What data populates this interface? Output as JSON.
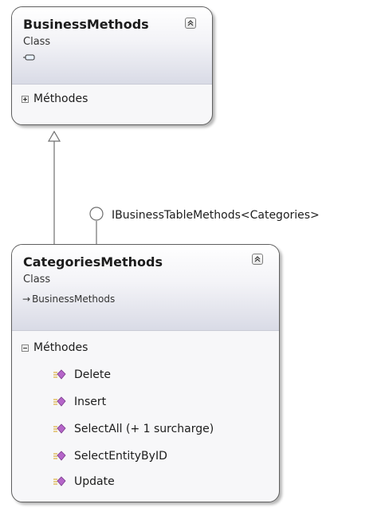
{
  "diagram": {
    "base_class": {
      "name": "BusinessMethods",
      "kind": "Class",
      "section_label": "Méthodes",
      "section_state": "collapsed"
    },
    "interface_label": "IBusinessTableMethods<Categories>",
    "derived_class": {
      "name": "CategoriesMethods",
      "kind": "Class",
      "base_ref": "BusinessMethods",
      "section_label": "Méthodes",
      "section_state": "expanded",
      "methods": [
        {
          "name": "Delete"
        },
        {
          "name": "Insert"
        },
        {
          "name": "SelectAll (+ 1 surcharge)"
        },
        {
          "name": "SelectEntityByID"
        },
        {
          "name": "Update"
        }
      ]
    },
    "colors": {
      "border": "#5f5f5f",
      "method_icon": "#b565c9",
      "method_icon_lines": "#d4a017",
      "connector": "#707070"
    }
  }
}
